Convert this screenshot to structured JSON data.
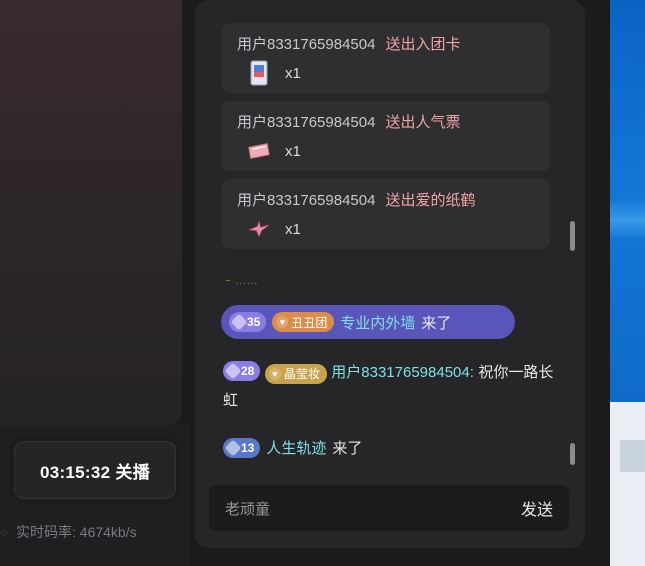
{
  "gifts": [
    {
      "user": "用户8331765984504",
      "action": "送出入团卡",
      "icon": "card-gift-icon",
      "count": "x1"
    },
    {
      "user": "用户8331765984504",
      "action": "送出人气票",
      "icon": "ticket-gift-icon",
      "count": "x1"
    },
    {
      "user": "用户8331765984504",
      "action": "送出爱的纸鹤",
      "icon": "paper-crane-gift-icon",
      "count": "x1"
    }
  ],
  "faded_text": "~ ......",
  "enter1": {
    "level": "35",
    "fan_badge": "丑丑团",
    "user": "专业内外墙",
    "suffix": "来了"
  },
  "comment": {
    "level": "28",
    "fan_badge": "晶莹妆",
    "user": "用户8331765984504:",
    "text": "祝你一路长虹"
  },
  "enter2": {
    "level": "13",
    "user": "人生轨迹",
    "suffix": "来了"
  },
  "input": {
    "placeholder": "老顽童",
    "send_label": "发送"
  },
  "live": {
    "end_label": "03:15:32 关播",
    "bitrate": "实时码率: 4674kb/s"
  },
  "colors": {
    "enter_bg": "#5a55b9",
    "name_cyan": "#7fe0e8",
    "gift_action": "#f1a4a4"
  }
}
